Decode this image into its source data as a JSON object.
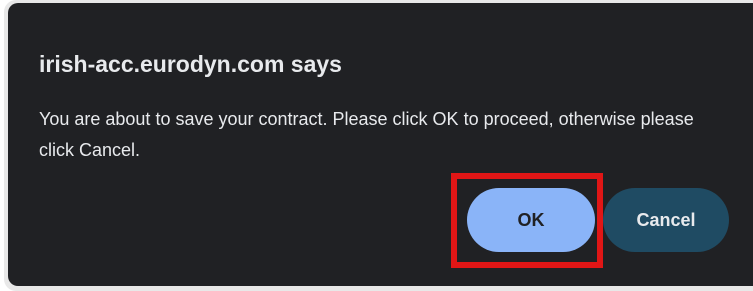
{
  "dialog": {
    "title": "irish-acc.eurodyn.com says",
    "message": "You are about to save your contract. Please click OK to proceed, otherwise please click Cancel.",
    "ok_label": "OK",
    "cancel_label": "Cancel"
  },
  "colors": {
    "dialog_background": "#202124",
    "text": "#e8eaed",
    "ok_button": "#8ab4f8",
    "cancel_button": "#1f4b63",
    "highlight_box": "#e01616"
  }
}
